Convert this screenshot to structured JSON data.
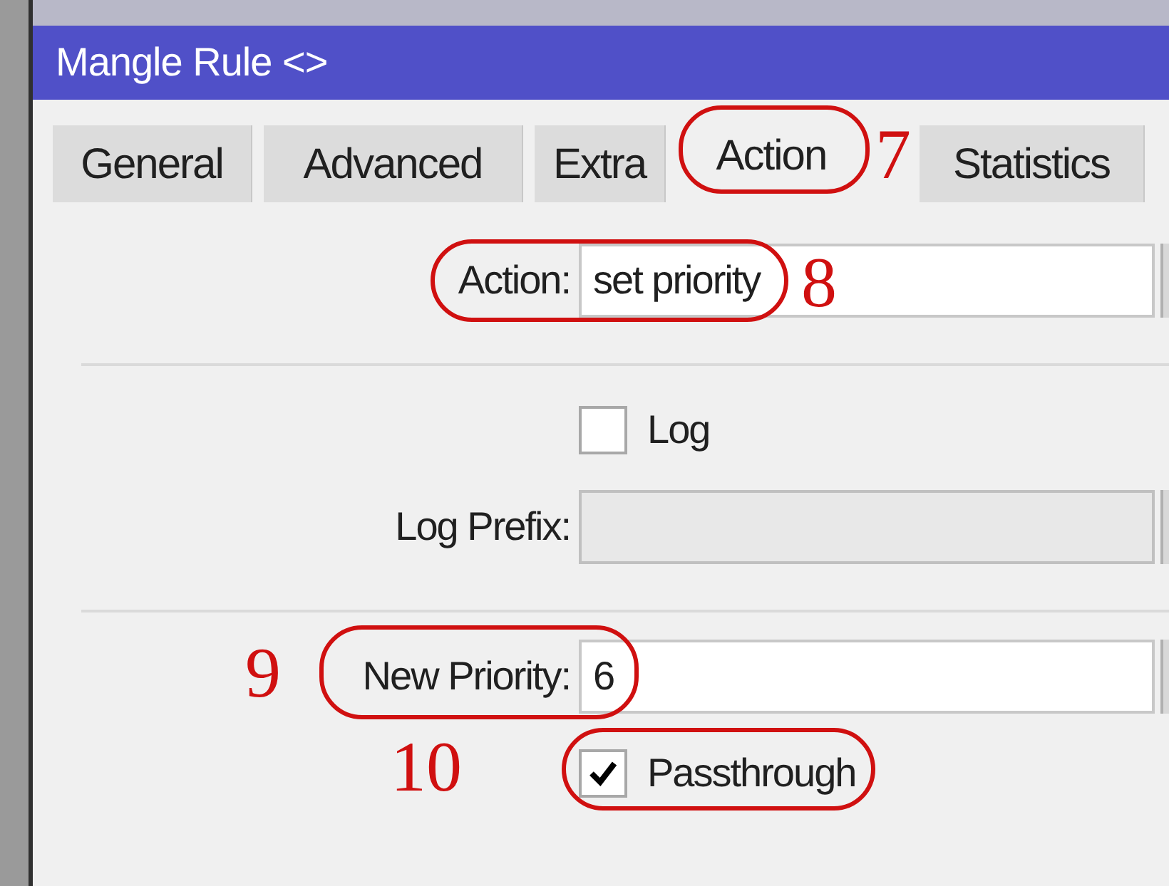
{
  "window": {
    "title": "Mangle Rule <>"
  },
  "tabs": [
    {
      "label": "General",
      "selected": false
    },
    {
      "label": "Advanced",
      "selected": false
    },
    {
      "label": "Extra",
      "selected": false
    },
    {
      "label": "Action",
      "selected": true
    },
    {
      "label": "Statistics",
      "selected": false
    }
  ],
  "rows": [
    {
      "kind": "field",
      "label": "Action:",
      "value": "set priority"
    },
    {
      "kind": "divider"
    },
    {
      "kind": "checkbox",
      "label": "Log",
      "checked": false
    },
    {
      "kind": "field",
      "label": "Log Prefix:",
      "value": "",
      "disabled": true
    },
    {
      "kind": "divider"
    },
    {
      "kind": "field",
      "label": "New Priority:",
      "value": "6"
    },
    {
      "kind": "checkbox",
      "label": "Passthrough",
      "checked": true
    }
  ],
  "annotations": [
    {
      "number": "7"
    },
    {
      "number": "8"
    },
    {
      "number": "9"
    },
    {
      "number": "10"
    }
  ]
}
